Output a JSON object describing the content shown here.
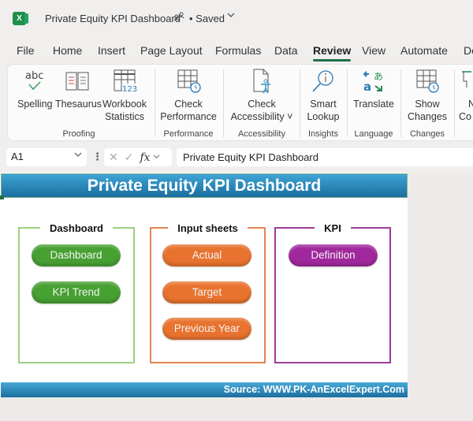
{
  "titlebar": {
    "app_icon": "excel-logo-icon",
    "app_letter": "X",
    "doc_title": "Private Equity KPI Dashboard",
    "share_icon": "people-share-icon",
    "status": "• Saved",
    "status_chevron": "⌵"
  },
  "menu": {
    "tabs": [
      {
        "label": "File"
      },
      {
        "label": "Home"
      },
      {
        "label": "Insert"
      },
      {
        "label": "Page Layout"
      },
      {
        "label": "Formulas"
      },
      {
        "label": "Data"
      },
      {
        "label": "Review",
        "active": true
      },
      {
        "label": "View"
      },
      {
        "label": "Automate"
      },
      {
        "label": "De"
      }
    ]
  },
  "ribbon": {
    "buttons": [
      {
        "name": "spelling",
        "label": "Spelling",
        "icon": "spelling-abc-check-icon"
      },
      {
        "name": "thesaurus",
        "label": "Thesaurus",
        "icon": "book-icon"
      },
      {
        "name": "workbook-statistics",
        "label": "Workbook\nStatistics",
        "line1": "Workbook",
        "line2": "Statistics",
        "icon": "grid-123-icon"
      },
      {
        "name": "check-performance",
        "line1": "Check",
        "line2": "Performance",
        "icon": "grid-timer-icon"
      },
      {
        "name": "check-accessibility",
        "line1": "Check",
        "line2": "Accessibility ˅",
        "icon": "document-accessibility-icon"
      },
      {
        "name": "smart-lookup",
        "line1": "Smart",
        "line2": "Lookup",
        "icon": "magnifier-info-icon"
      },
      {
        "name": "translate",
        "line1": "Translate",
        "icon": "translate-icon"
      },
      {
        "name": "show-changes",
        "line1": "Show",
        "line2": "Changes",
        "icon": "grid-history-icon"
      },
      {
        "name": "comments",
        "line1": "N",
        "line2": "Co",
        "icon": "comment-icon"
      }
    ],
    "groups": [
      "Proofing",
      "Performance",
      "Accessibility",
      "Insights",
      "Language",
      "Changes"
    ]
  },
  "formula_bar": {
    "name_box": "A1",
    "dots": "⋮",
    "cancel": "✕",
    "enter": "✓",
    "fx": "fx",
    "formula": "Private Equity KPI Dashboard"
  },
  "sheet": {
    "banner_title": "Private Equity KPI Dashboard",
    "sections": [
      {
        "title": "Dashboard",
        "color": "#9dd07f",
        "pill_color": "#47a032",
        "buttons": [
          "Dashboard",
          "KPI Trend"
        ]
      },
      {
        "title": "Input sheets",
        "color": "#e38552",
        "pill_color": "#e8732e",
        "buttons": [
          "Actual",
          "Target",
          "Previous Year"
        ]
      },
      {
        "title": "KPI",
        "color": "#9d3c9a",
        "pill_color": "#a0289c",
        "buttons": [
          "Definition"
        ]
      }
    ],
    "footer": "Source: WWW.PK-AnExcelExpert.Com"
  },
  "colors": {
    "accent_green": "#1e6e45",
    "banner_blue": "#2b87bb"
  }
}
